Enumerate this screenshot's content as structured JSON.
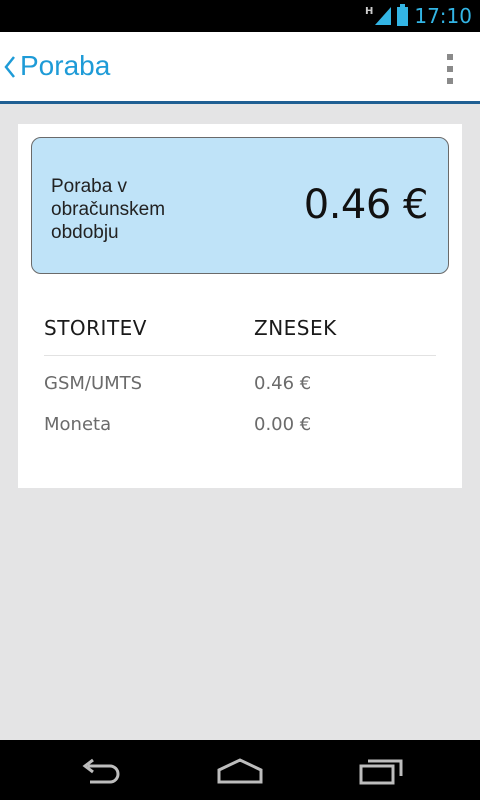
{
  "status_bar": {
    "network_type": "H",
    "time": "17:10",
    "accent_color": "#33b5e5"
  },
  "action_bar": {
    "title": "Poraba",
    "back_icon": "chevron-left-icon",
    "menu_icon": "overflow-menu-icon",
    "title_color": "#1e9bd7"
  },
  "summary": {
    "label": "Poraba v obračunskem obdobju",
    "amount": "0.46 €",
    "background": "#bfe3f8"
  },
  "table": {
    "headers": [
      "STORITEV",
      "ZNESEK"
    ],
    "rows": [
      {
        "service": "GSM/UMTS",
        "amount": "0.46 €"
      },
      {
        "service": "Moneta",
        "amount": "0.00 €"
      }
    ]
  },
  "nav_bar": {
    "buttons": [
      "back-icon",
      "home-icon",
      "recent-apps-icon"
    ]
  }
}
